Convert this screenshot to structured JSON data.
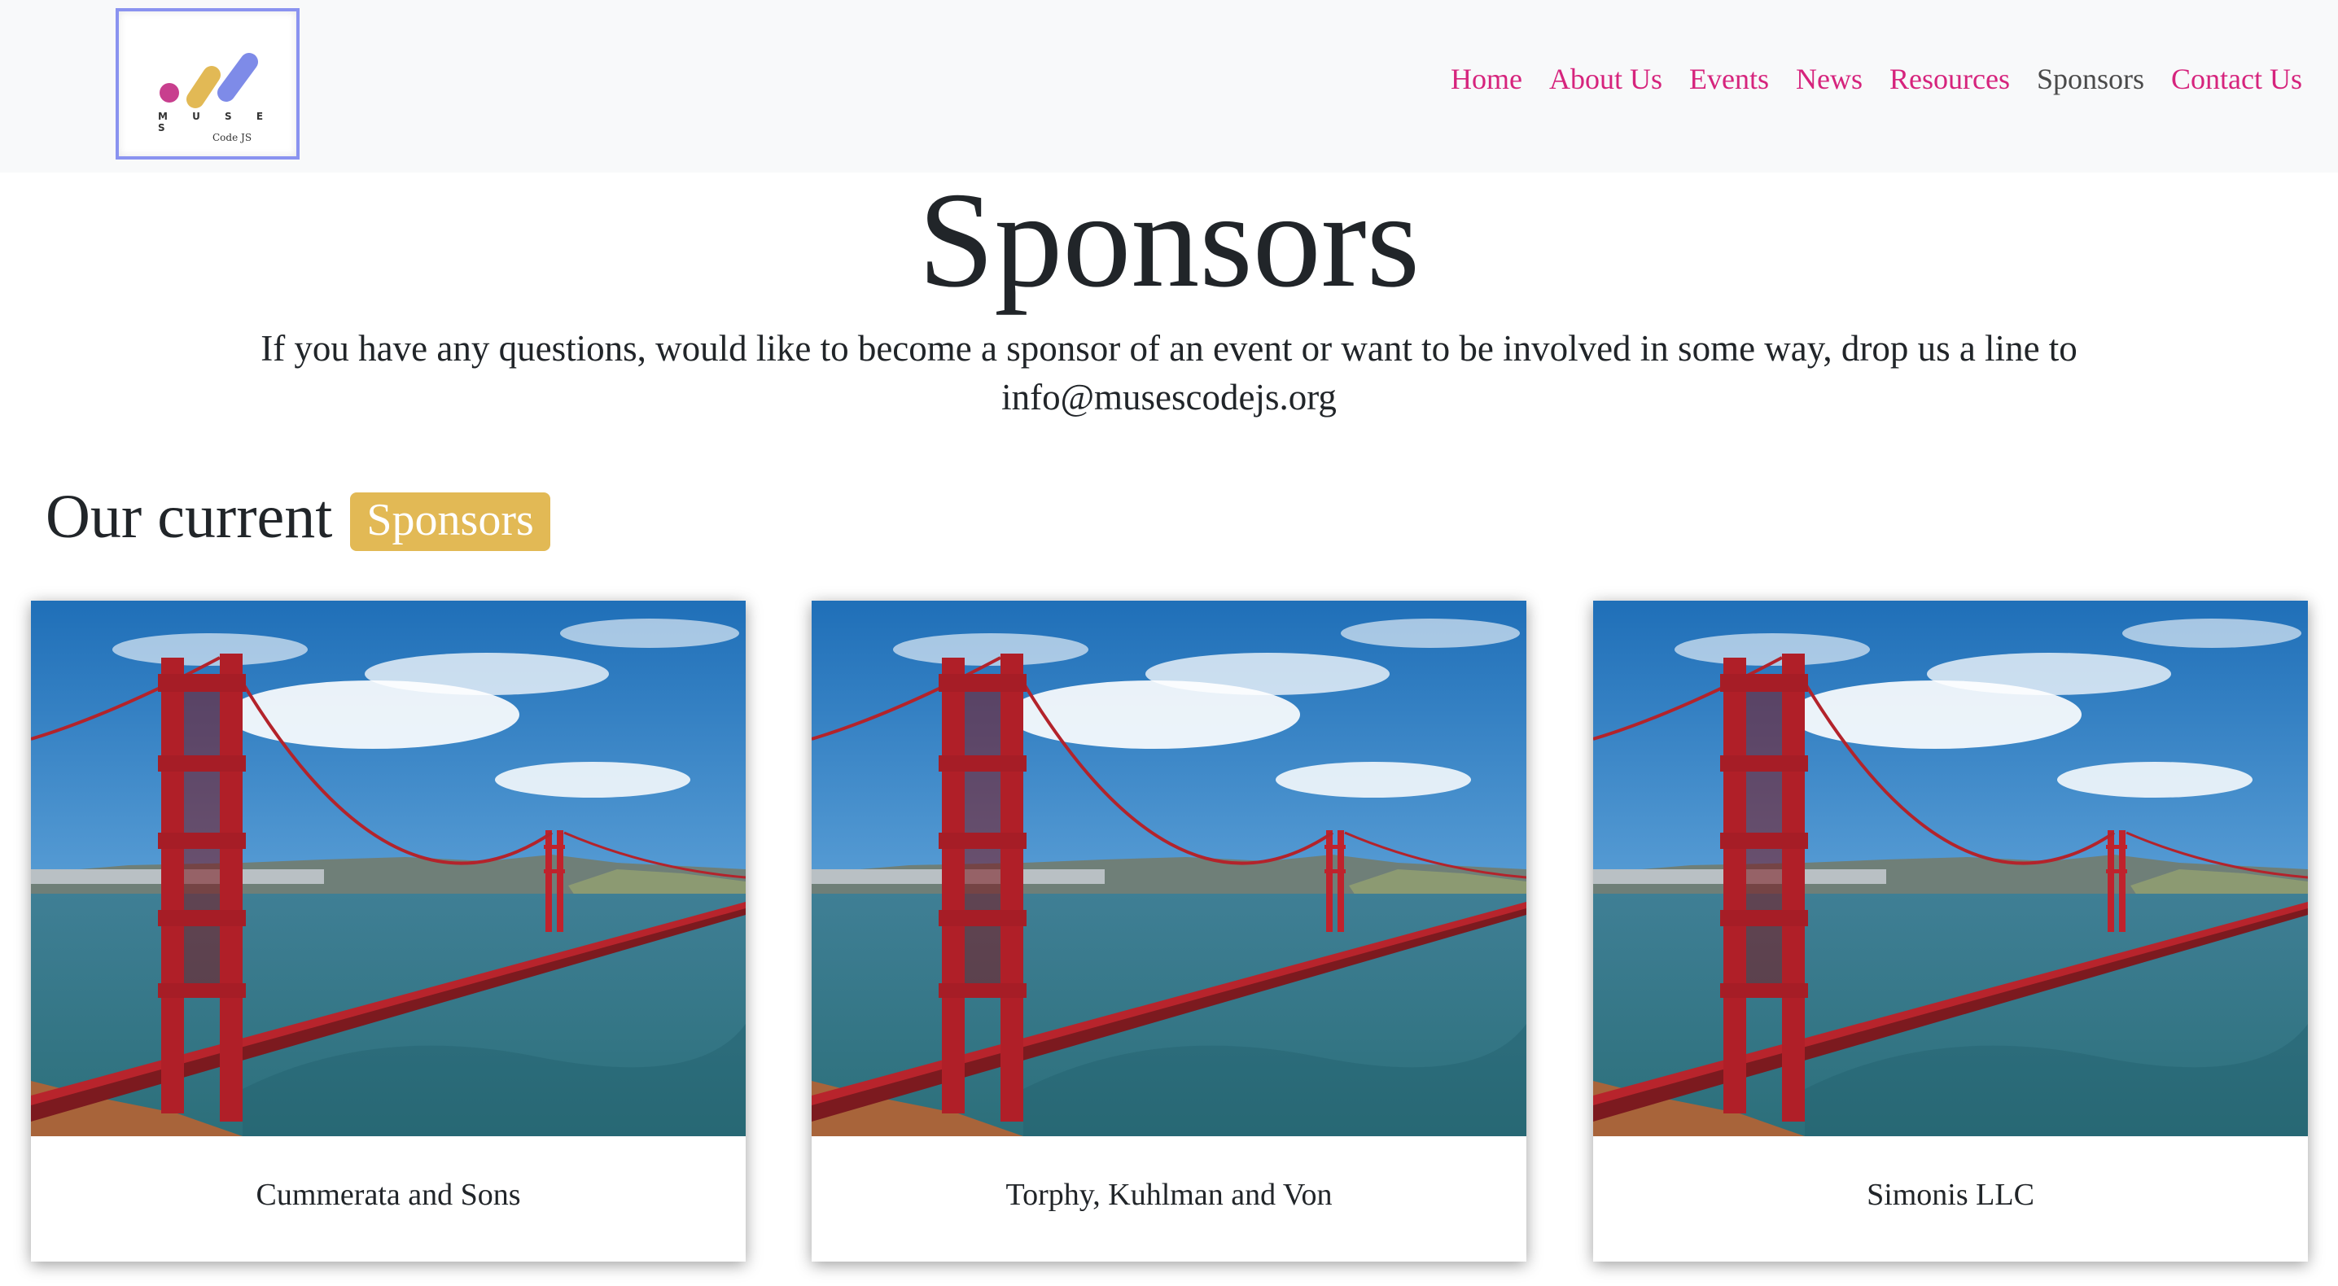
{
  "logo": {
    "wordmark": "M U S E S",
    "subtext": "Code JS",
    "colors": {
      "dot": "#c83f8e",
      "bar1": "#e2b955",
      "bar2": "#7e8be8"
    }
  },
  "nav": {
    "items": [
      {
        "label": "Home",
        "active": false
      },
      {
        "label": "About Us",
        "active": false
      },
      {
        "label": "Events",
        "active": false
      },
      {
        "label": "News",
        "active": false
      },
      {
        "label": "Resources",
        "active": false
      },
      {
        "label": "Sponsors",
        "active": true
      },
      {
        "label": "Contact Us",
        "active": false
      }
    ],
    "link_color": "#d6247d",
    "active_color": "#4a4a4a"
  },
  "page": {
    "title": "Sponsors",
    "intro": "If you have any questions, would like to become a sponsor of an event or want to be involved in some way, drop us a line to info@musescodejs.org"
  },
  "section": {
    "heading": "Our current",
    "badge": "Sponsors",
    "badge_color": "#e2b955"
  },
  "sponsors": [
    {
      "name": "Cummerata and Sons",
      "image": "golden-gate-bridge-photo"
    },
    {
      "name": "Torphy, Kuhlman and Von",
      "image": "golden-gate-bridge-photo"
    },
    {
      "name": "Simonis LLC",
      "image": "golden-gate-bridge-photo"
    }
  ]
}
